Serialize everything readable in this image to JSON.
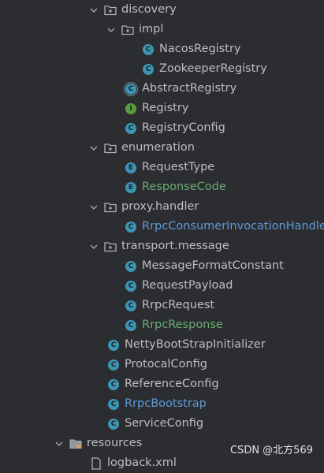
{
  "tree": {
    "discovery": "discovery",
    "impl": "impl",
    "nacos_registry": "NacosRegistry",
    "zookeeper_registry": "ZookeeperRegistry",
    "abstract_registry": "AbstractRegistry",
    "registry": "Registry",
    "registry_config": "RegistryConfig",
    "enumeration": "enumeration",
    "request_type": "RequestType",
    "response_code": "ResponseCode",
    "proxy_handler": "proxy.handler",
    "rrpc_consumer_invocation_handler": "RrpcConsumerInvocationHandler",
    "transport_message": "transport.message",
    "message_format_constant": "MessageFormatConstant",
    "request_payload": "RequestPayload",
    "rrpc_request": "RrpcRequest",
    "rrpc_response": "RrpcResponse",
    "netty_bootstrap_initializer": "NettyBootStrapInitializer",
    "protocal_config": "ProtocalConfig",
    "reference_config": "ReferenceConfig",
    "rrpc_bootstrap": "RrpcBootstrap",
    "service_config": "ServiceConfig",
    "resources": "resources",
    "logback_xml": "logback.xml"
  },
  "badges": {
    "class": "C",
    "enum": "E",
    "interface": "I"
  },
  "icons": {
    "chevron": "chevron-down-icon",
    "folder": "folder-icon",
    "class": "class-icon",
    "enum": "enum-icon",
    "interface": "interface-icon",
    "xml": "xml-file-icon"
  },
  "colors": {
    "background": "#2b2d30",
    "text": "#bcbec4",
    "modified_green": "#6aab73",
    "new_blue": "#5f9bd8",
    "class_badge": "#3d95b4",
    "interface_badge": "#5a9f3e"
  },
  "watermark": "CSDN @北方569"
}
